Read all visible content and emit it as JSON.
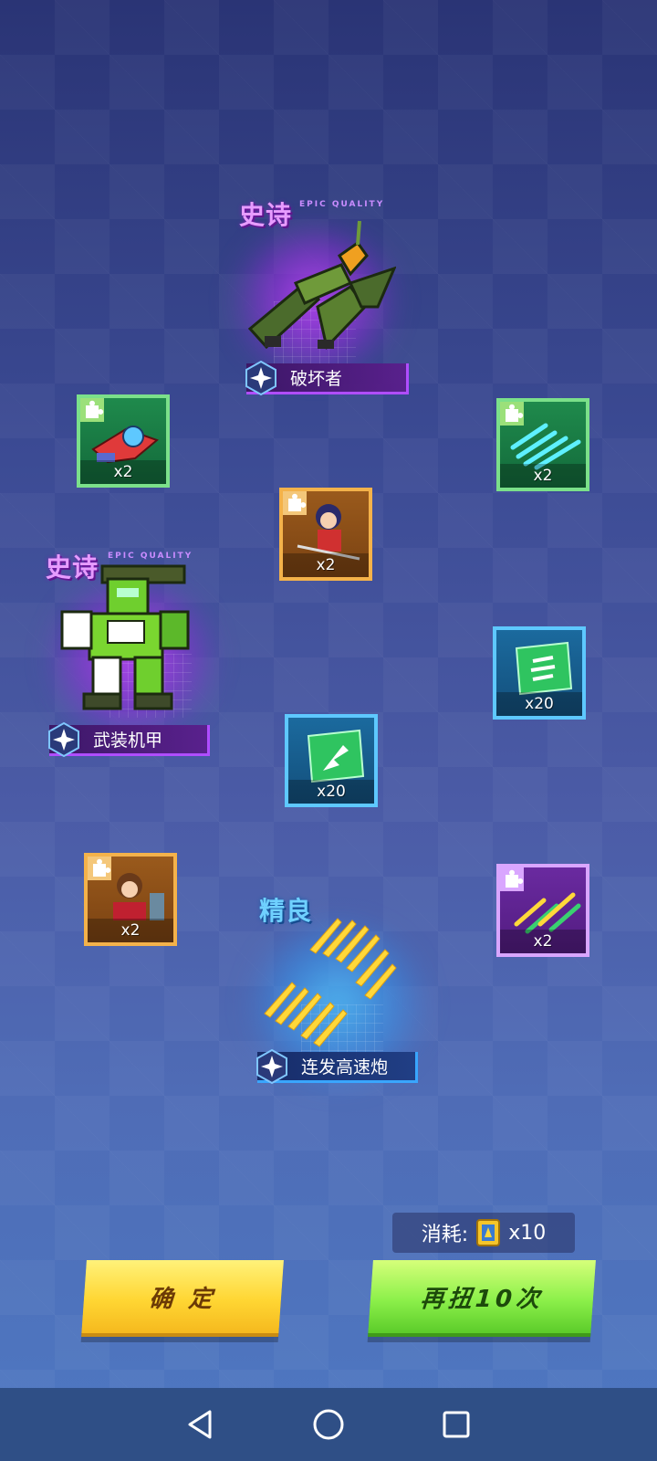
{
  "featured": [
    {
      "quality_cn": "史诗",
      "quality_en": "EPIC QUALITY",
      "name": "破坏者",
      "tier": "epic",
      "art": "jet-fighter-icon"
    },
    {
      "quality_cn": "史诗",
      "quality_en": "EPIC QUALITY",
      "name": "武装机甲",
      "tier": "epic",
      "art": "mech-robot-icon"
    },
    {
      "quality_cn": "精良",
      "quality_en": "",
      "name": "连发高速炮",
      "tier": "fine",
      "art": "golden-bullets-icon"
    }
  ],
  "cards": [
    {
      "count": "x2",
      "tier": "green",
      "art": "red-plane-icon",
      "puzzle": true
    },
    {
      "count": "x2",
      "tier": "green",
      "art": "cyan-streaks-icon",
      "puzzle": true
    },
    {
      "count": "x2",
      "tier": "orange",
      "art": "ninja-girl-icon",
      "puzzle": true
    },
    {
      "count": "x20",
      "tier": "blue",
      "art": "missile-chip-icon",
      "puzzle": false
    },
    {
      "count": "x20",
      "tier": "blue",
      "art": "plane-chip-icon",
      "puzzle": false
    },
    {
      "count": "x2",
      "tier": "orange",
      "art": "girl-with-robots-icon",
      "puzzle": true
    },
    {
      "count": "x2",
      "tier": "purple",
      "art": "green-gold-streaks-icon",
      "puzzle": true
    }
  ],
  "cost": {
    "label": "消耗:",
    "amount": "x10",
    "icon": "ticket-icon"
  },
  "buttons": {
    "confirm": "确 定",
    "again": "再扭10次"
  },
  "nav": [
    "back-icon",
    "home-icon",
    "recents-icon"
  ]
}
